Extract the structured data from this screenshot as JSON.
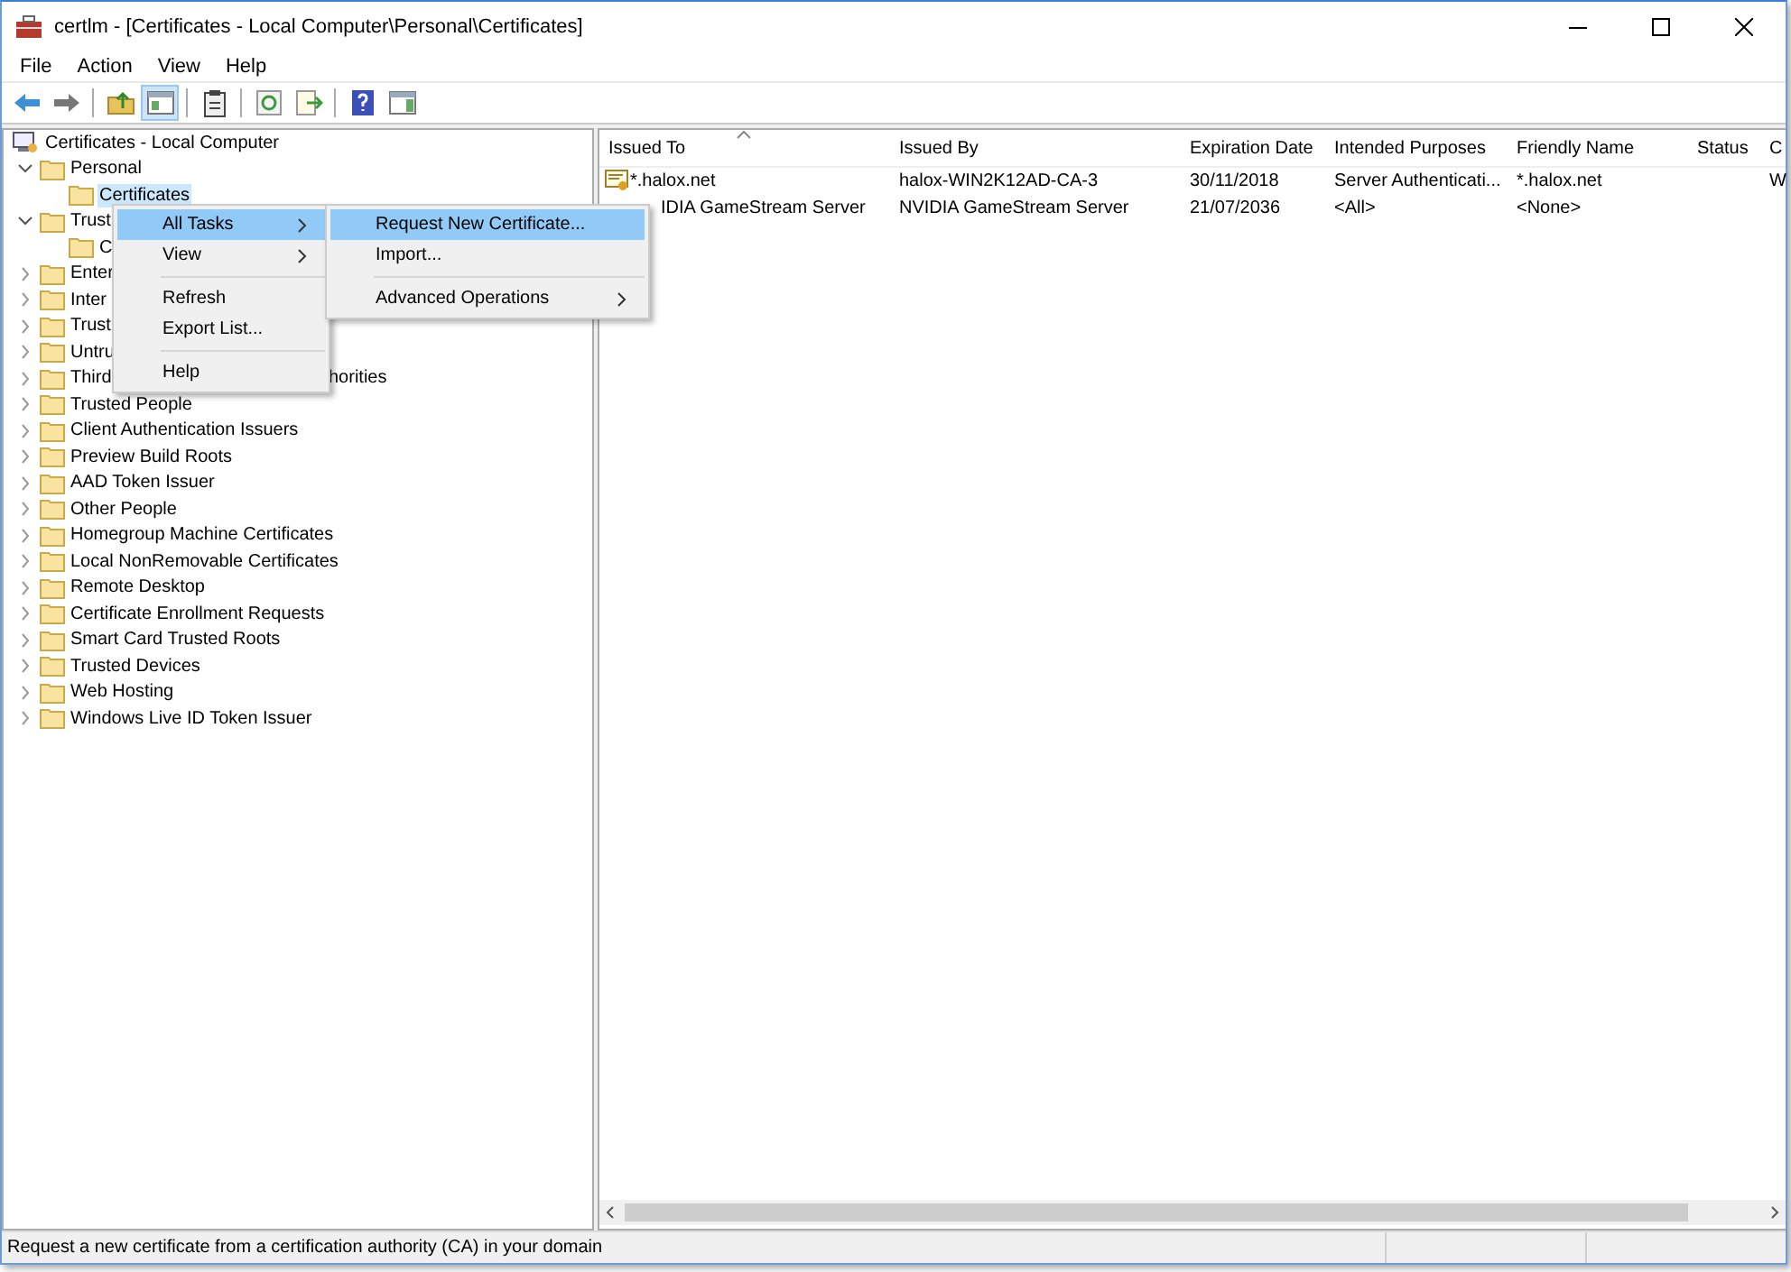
{
  "window": {
    "title": "certlm - [Certificates - Local Computer\\Personal\\Certificates]"
  },
  "menu_bar": [
    "File",
    "Action",
    "View",
    "Help"
  ],
  "tree": {
    "label": "Certificates - Local Computer",
    "selected": false,
    "children": [
      {
        "label": "Personal",
        "expanded": true,
        "selected": false,
        "children": [
          {
            "label": "Certificates",
            "selected": true
          }
        ]
      },
      {
        "label": "Trust",
        "expanded": true,
        "selected": false,
        "children": [
          {
            "label": "C",
            "selected": false
          }
        ]
      },
      {
        "label": "Enter",
        "expanded": false,
        "selected": false
      },
      {
        "label": "Inter",
        "expanded": false,
        "selected": false
      },
      {
        "label": "Trust",
        "expanded": false,
        "selected": false
      },
      {
        "label": "Untru",
        "expanded": false,
        "selected": false
      },
      {
        "label": "Third",
        "label_tail": "horities",
        "expanded": false,
        "selected": false
      },
      {
        "label": "Trusted People",
        "expanded": false,
        "selected": false
      },
      {
        "label": "Client Authentication Issuers",
        "expanded": false,
        "selected": false
      },
      {
        "label": "Preview Build Roots",
        "expanded": false,
        "selected": false
      },
      {
        "label": "AAD Token Issuer",
        "expanded": false,
        "selected": false
      },
      {
        "label": "Other People",
        "expanded": false,
        "selected": false
      },
      {
        "label": "Homegroup Machine Certificates",
        "expanded": false,
        "selected": false
      },
      {
        "label": "Local NonRemovable Certificates",
        "expanded": false,
        "selected": false
      },
      {
        "label": "Remote Desktop",
        "expanded": false,
        "selected": false
      },
      {
        "label": "Certificate Enrollment Requests",
        "expanded": false,
        "selected": false
      },
      {
        "label": "Smart Card Trusted Roots",
        "expanded": false,
        "selected": false
      },
      {
        "label": "Trusted Devices",
        "expanded": false,
        "selected": false
      },
      {
        "label": "Web Hosting",
        "expanded": false,
        "selected": false
      },
      {
        "label": "Windows Live ID Token Issuer",
        "expanded": false,
        "selected": false
      }
    ]
  },
  "table": {
    "columns": [
      "Issued To",
      "Issued By",
      "Expiration Date",
      "Intended Purposes",
      "Friendly Name",
      "Status",
      "C"
    ],
    "rows": [
      {
        "icon": true,
        "cells": [
          "*.halox.net",
          "halox-WIN2K12AD-CA-3",
          "30/11/2018",
          "Server Authenticati...",
          "*.halox.net",
          "",
          "W"
        ]
      },
      {
        "icon": false,
        "cells": [
          "IDIA GameStream Server",
          "NVIDIA GameStream Server",
          "21/07/2036",
          "<All>",
          "<None>",
          "",
          ""
        ]
      }
    ]
  },
  "context_menu": [
    {
      "kind": "item",
      "label": "All Tasks",
      "submenu": true,
      "selected": true
    },
    {
      "kind": "item",
      "label": "View",
      "submenu": true,
      "selected": false
    },
    {
      "kind": "separator"
    },
    {
      "kind": "item",
      "label": "Refresh",
      "submenu": false,
      "selected": false
    },
    {
      "kind": "item",
      "label": "Export List...",
      "submenu": false,
      "selected": false
    },
    {
      "kind": "separator"
    },
    {
      "kind": "item",
      "label": "Help",
      "submenu": false,
      "selected": false
    }
  ],
  "submenu": [
    {
      "kind": "item",
      "label": "Request New Certificate...",
      "submenu": false,
      "selected": true
    },
    {
      "kind": "item",
      "label": "Import...",
      "submenu": false,
      "selected": false
    },
    {
      "kind": "separator"
    },
    {
      "kind": "item",
      "label": "Advanced Operations",
      "submenu": true,
      "selected": false
    }
  ],
  "status_bar": "Request a new certificate from a certification authority (CA) in your domain"
}
